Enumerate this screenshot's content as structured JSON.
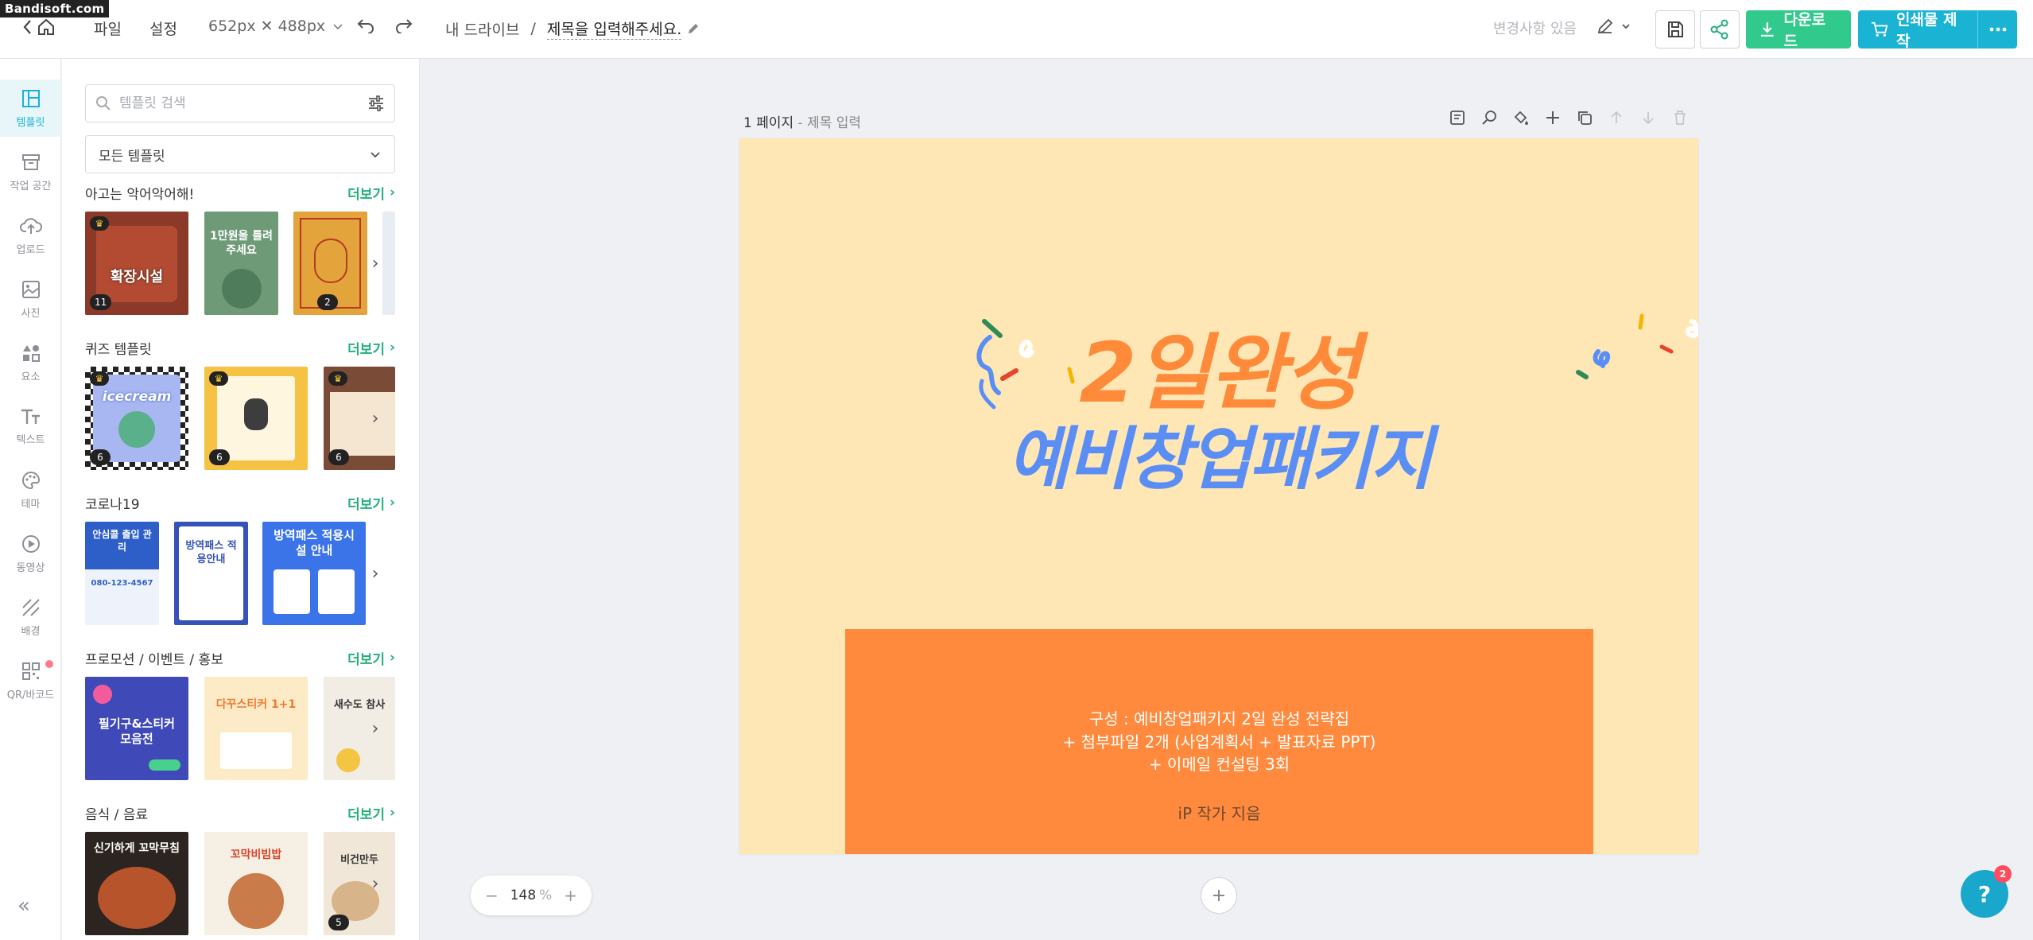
{
  "watermark": "Bandisoft.com",
  "header": {
    "menu_file": "파일",
    "menu_settings": "설정",
    "size_label": "652px ✕ 488px",
    "breadcrumb_drive": "내 드라이브",
    "breadcrumb_sep": "/",
    "doc_title": "제목을 입력해주세요.",
    "save_status": "변경사항 있음",
    "download_label": "다운로드",
    "print_label": "인쇄물 제작"
  },
  "leftnav": {
    "items": [
      {
        "label": "템플릿",
        "icon": "layout-icon"
      },
      {
        "label": "작업 공간",
        "icon": "archive-icon"
      },
      {
        "label": "업로드",
        "icon": "cloud-upload-icon"
      },
      {
        "label": "사진",
        "icon": "image-icon"
      },
      {
        "label": "요소",
        "icon": "shapes-icon"
      },
      {
        "label": "텍스트",
        "icon": "text-icon"
      },
      {
        "label": "테마",
        "icon": "palette-icon"
      },
      {
        "label": "동영상",
        "icon": "play-icon"
      },
      {
        "label": "배경",
        "icon": "pattern-icon"
      },
      {
        "label": "QR/바코드",
        "icon": "qr-icon"
      }
    ],
    "collapse": "«"
  },
  "panel": {
    "search_placeholder": "템플릿 검색",
    "category_select": "모든 템플릿",
    "more_label": "더보기",
    "sections": [
      {
        "title": "아고는 악어악어해!",
        "thumbs": [
          {
            "text": "확장시설",
            "badge": "11"
          },
          {
            "text": "1만원을 틀려주세요",
            "badge": ""
          },
          {
            "text": "",
            "badge": "2"
          }
        ]
      },
      {
        "title": "퀴즈 템플릿",
        "thumbs": [
          {
            "text": "icecream",
            "badge": "6"
          },
          {
            "text": "",
            "badge": "6"
          },
          {
            "text": "",
            "badge": "6"
          }
        ]
      },
      {
        "title": "코로나19",
        "thumbs": [
          {
            "text": "안심콜 출입 관리",
            "sub": "080-123-4567",
            "badge": ""
          },
          {
            "text": "방역패스 적용안내",
            "badge": ""
          },
          {
            "text": "방역패스 적용시설 안내",
            "badge": ""
          }
        ]
      },
      {
        "title": "프로모션 / 이벤트 / 홍보",
        "thumbs": [
          {
            "text": "필기구&스티커 모음전",
            "badge": ""
          },
          {
            "text": "다꾸스티커 1+1",
            "badge": ""
          },
          {
            "text": "새수도 참사",
            "badge": ""
          }
        ]
      },
      {
        "title": "음식 / 음료",
        "thumbs": [
          {
            "text": "신기하게 꼬막무침",
            "badge": ""
          },
          {
            "text": "꼬막비빔밥",
            "badge": ""
          },
          {
            "text": "비건만두",
            "badge": "5"
          }
        ]
      }
    ]
  },
  "canvas": {
    "page_number": "1 페이지",
    "page_title": "- 제목 입력",
    "headline1": "2일완성",
    "headline2": "예비창업패키지",
    "line1": "구성 : 예비창업패키지 2일 완성 전략집",
    "line2": "+ 첨부파일 2개 (사업계획서 + 발표자료 PPT)",
    "line3": "+ 이메일 컨설팅 3회",
    "author": "iP 작가 지음",
    "bg_color": "#ffe7b5",
    "box_color": "#ff8a3d",
    "headline1_color": "#ff8a3a",
    "headline2_color": "#5b8ef5"
  },
  "zoom": {
    "minus": "−",
    "value": "148",
    "unit": "%",
    "plus": "+"
  },
  "help": {
    "label": "?",
    "badge": "2"
  },
  "colors": {
    "accent_teal": "#1ab3d4",
    "accent_green": "#32c98c"
  }
}
